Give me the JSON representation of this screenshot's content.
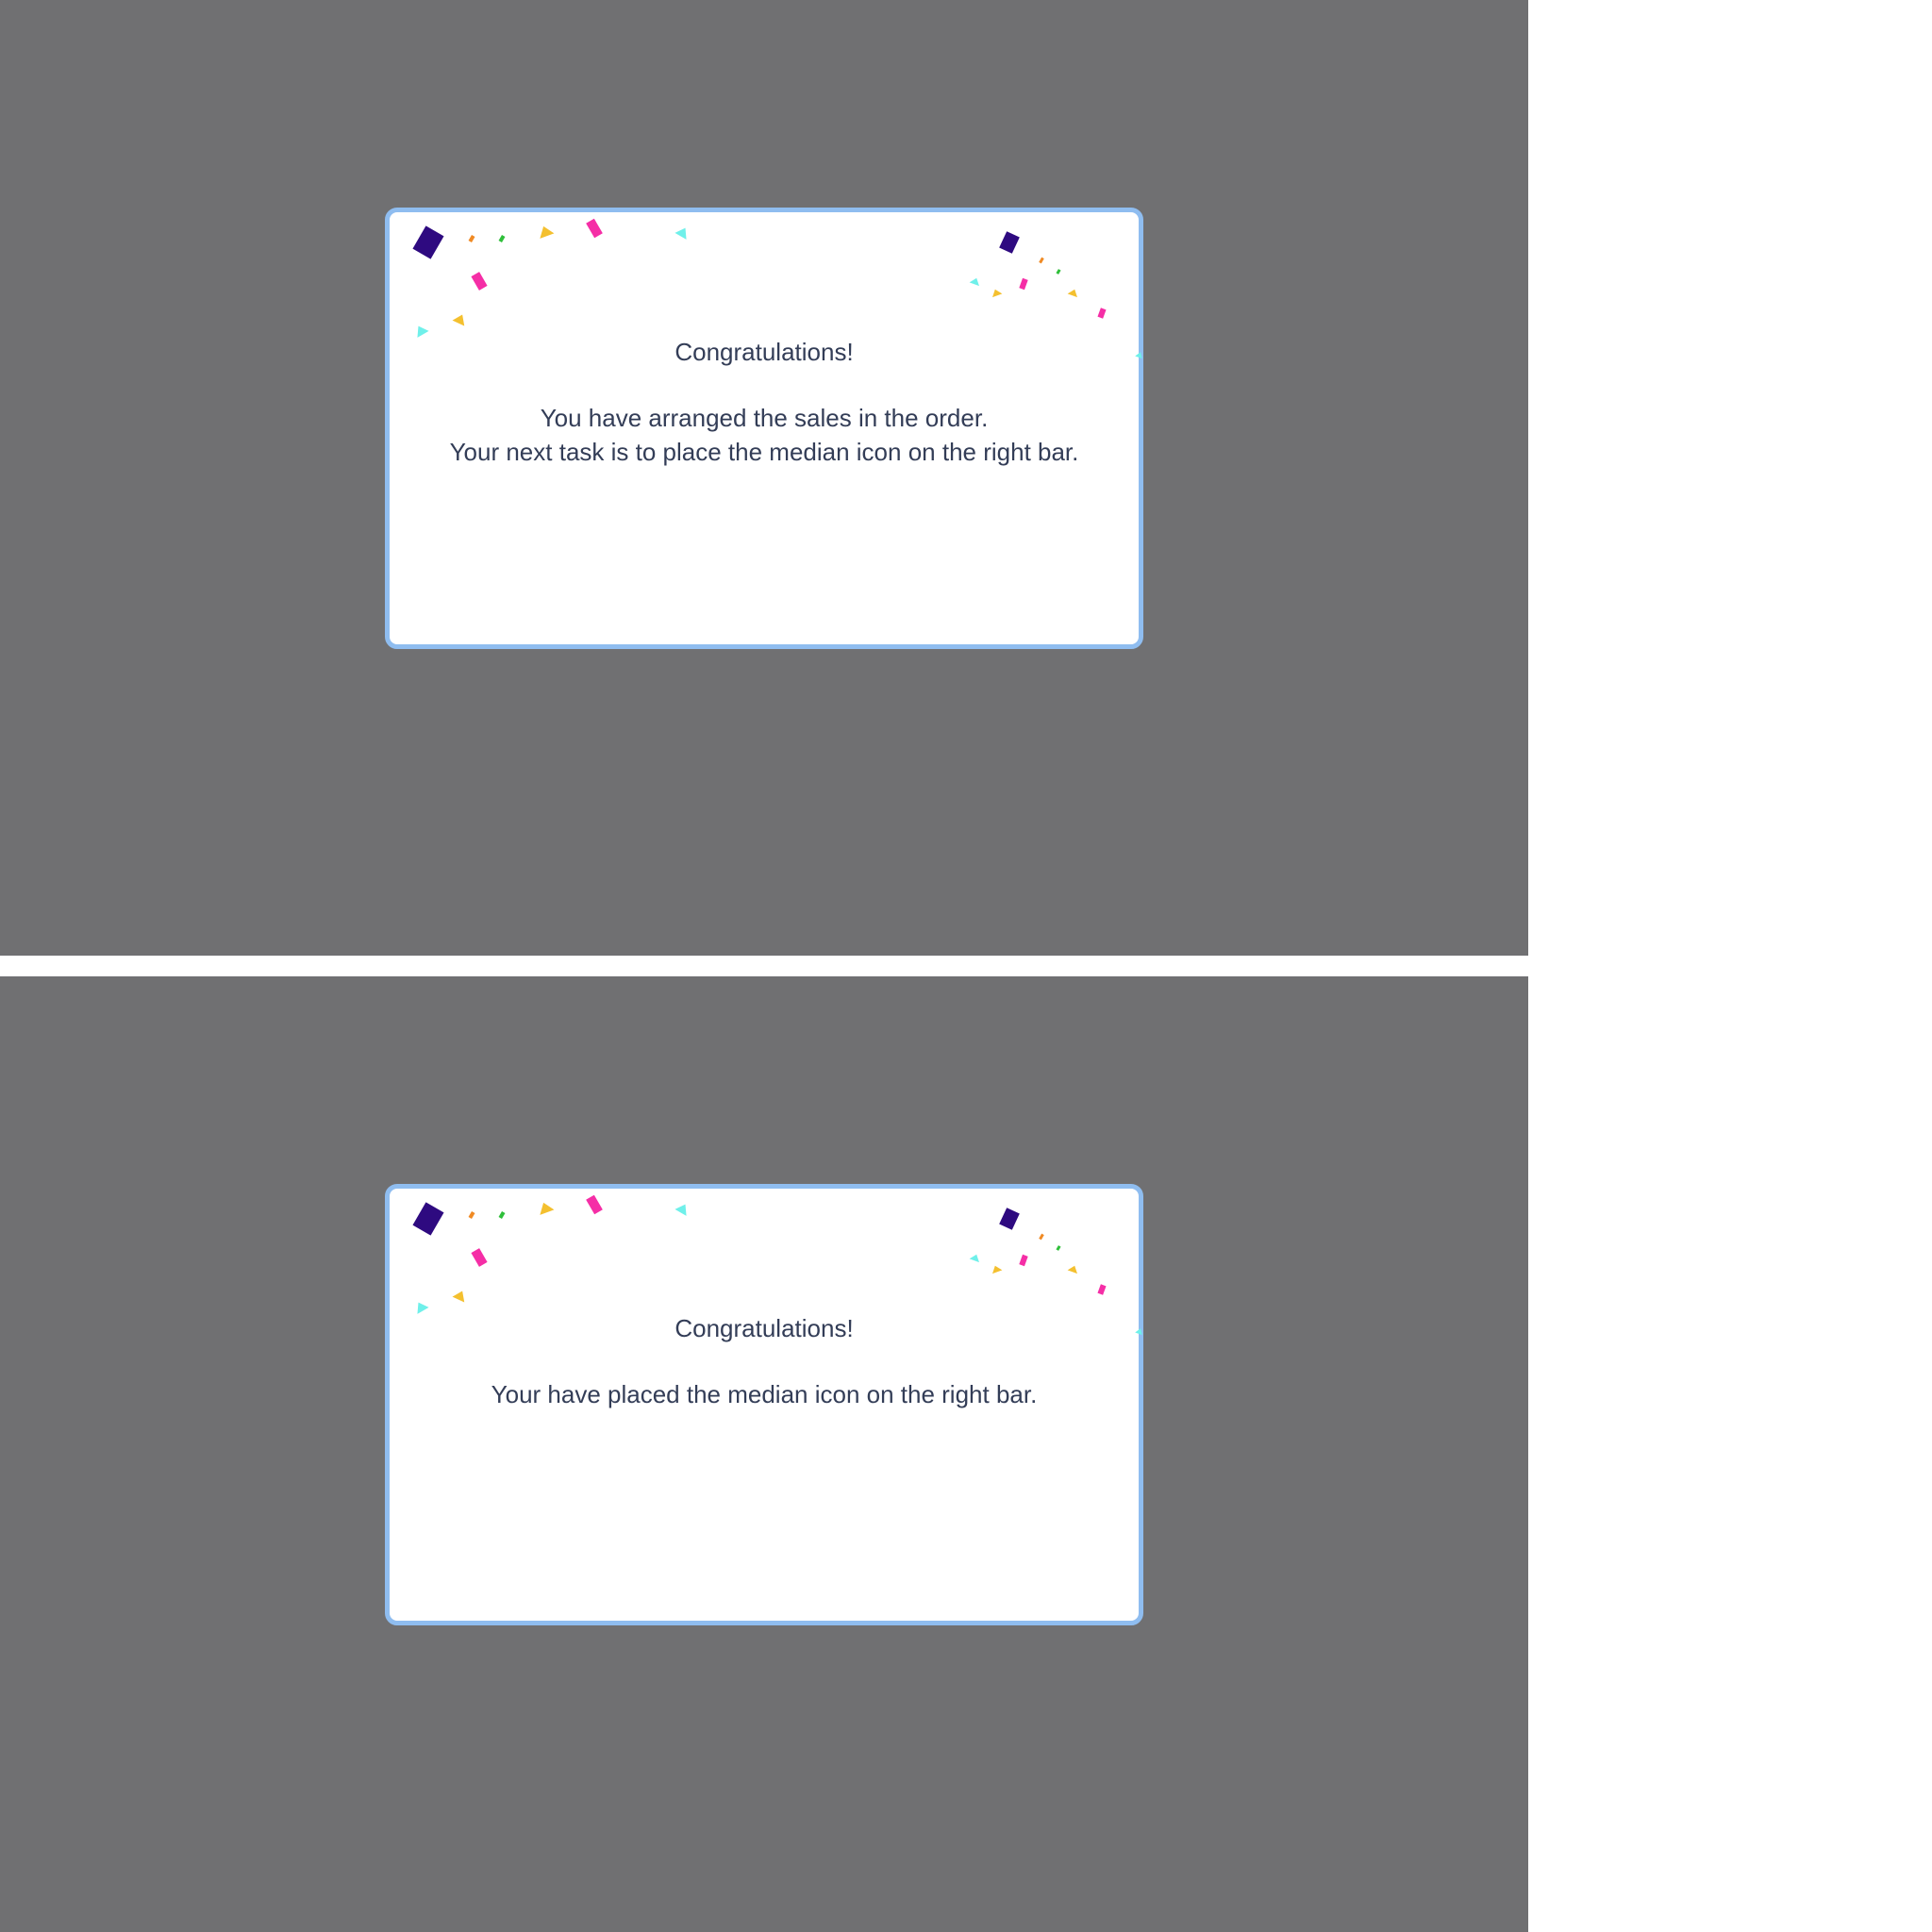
{
  "dialogs": [
    {
      "title": "Congratulations!",
      "lines": [
        "You have arranged the sales in the order.",
        "Your next task is to place the median icon on the right bar."
      ]
    },
    {
      "title": "Congratulations!",
      "lines": [
        "Your have placed the median icon on the right bar."
      ]
    }
  ],
  "colors": {
    "overlay": "#707072",
    "dialog_border": "#8fbdf0",
    "text": "#333d57",
    "confetti": [
      "#2e0a80",
      "#f52ea6",
      "#f4c02f",
      "#6ff0ea",
      "#f08a24",
      "#2fbf3a"
    ]
  }
}
